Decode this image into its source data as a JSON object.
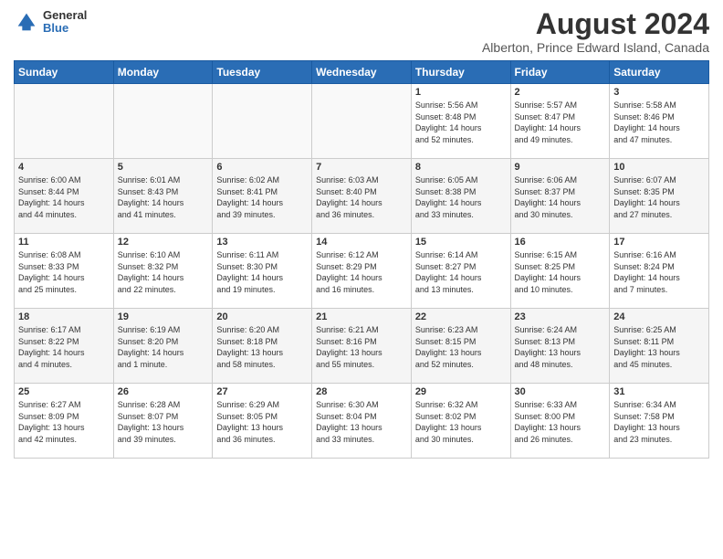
{
  "logo": {
    "general": "General",
    "blue": "Blue"
  },
  "title": {
    "month_year": "August 2024",
    "location": "Alberton, Prince Edward Island, Canada"
  },
  "headers": [
    "Sunday",
    "Monday",
    "Tuesday",
    "Wednesday",
    "Thursday",
    "Friday",
    "Saturday"
  ],
  "weeks": [
    [
      {
        "day": "",
        "info": ""
      },
      {
        "day": "",
        "info": ""
      },
      {
        "day": "",
        "info": ""
      },
      {
        "day": "",
        "info": ""
      },
      {
        "day": "1",
        "info": "Sunrise: 5:56 AM\nSunset: 8:48 PM\nDaylight: 14 hours\nand 52 minutes."
      },
      {
        "day": "2",
        "info": "Sunrise: 5:57 AM\nSunset: 8:47 PM\nDaylight: 14 hours\nand 49 minutes."
      },
      {
        "day": "3",
        "info": "Sunrise: 5:58 AM\nSunset: 8:46 PM\nDaylight: 14 hours\nand 47 minutes."
      }
    ],
    [
      {
        "day": "4",
        "info": "Sunrise: 6:00 AM\nSunset: 8:44 PM\nDaylight: 14 hours\nand 44 minutes."
      },
      {
        "day": "5",
        "info": "Sunrise: 6:01 AM\nSunset: 8:43 PM\nDaylight: 14 hours\nand 41 minutes."
      },
      {
        "day": "6",
        "info": "Sunrise: 6:02 AM\nSunset: 8:41 PM\nDaylight: 14 hours\nand 39 minutes."
      },
      {
        "day": "7",
        "info": "Sunrise: 6:03 AM\nSunset: 8:40 PM\nDaylight: 14 hours\nand 36 minutes."
      },
      {
        "day": "8",
        "info": "Sunrise: 6:05 AM\nSunset: 8:38 PM\nDaylight: 14 hours\nand 33 minutes."
      },
      {
        "day": "9",
        "info": "Sunrise: 6:06 AM\nSunset: 8:37 PM\nDaylight: 14 hours\nand 30 minutes."
      },
      {
        "day": "10",
        "info": "Sunrise: 6:07 AM\nSunset: 8:35 PM\nDaylight: 14 hours\nand 27 minutes."
      }
    ],
    [
      {
        "day": "11",
        "info": "Sunrise: 6:08 AM\nSunset: 8:33 PM\nDaylight: 14 hours\nand 25 minutes."
      },
      {
        "day": "12",
        "info": "Sunrise: 6:10 AM\nSunset: 8:32 PM\nDaylight: 14 hours\nand 22 minutes."
      },
      {
        "day": "13",
        "info": "Sunrise: 6:11 AM\nSunset: 8:30 PM\nDaylight: 14 hours\nand 19 minutes."
      },
      {
        "day": "14",
        "info": "Sunrise: 6:12 AM\nSunset: 8:29 PM\nDaylight: 14 hours\nand 16 minutes."
      },
      {
        "day": "15",
        "info": "Sunrise: 6:14 AM\nSunset: 8:27 PM\nDaylight: 14 hours\nand 13 minutes."
      },
      {
        "day": "16",
        "info": "Sunrise: 6:15 AM\nSunset: 8:25 PM\nDaylight: 14 hours\nand 10 minutes."
      },
      {
        "day": "17",
        "info": "Sunrise: 6:16 AM\nSunset: 8:24 PM\nDaylight: 14 hours\nand 7 minutes."
      }
    ],
    [
      {
        "day": "18",
        "info": "Sunrise: 6:17 AM\nSunset: 8:22 PM\nDaylight: 14 hours\nand 4 minutes."
      },
      {
        "day": "19",
        "info": "Sunrise: 6:19 AM\nSunset: 8:20 PM\nDaylight: 14 hours\nand 1 minute."
      },
      {
        "day": "20",
        "info": "Sunrise: 6:20 AM\nSunset: 8:18 PM\nDaylight: 13 hours\nand 58 minutes."
      },
      {
        "day": "21",
        "info": "Sunrise: 6:21 AM\nSunset: 8:16 PM\nDaylight: 13 hours\nand 55 minutes."
      },
      {
        "day": "22",
        "info": "Sunrise: 6:23 AM\nSunset: 8:15 PM\nDaylight: 13 hours\nand 52 minutes."
      },
      {
        "day": "23",
        "info": "Sunrise: 6:24 AM\nSunset: 8:13 PM\nDaylight: 13 hours\nand 48 minutes."
      },
      {
        "day": "24",
        "info": "Sunrise: 6:25 AM\nSunset: 8:11 PM\nDaylight: 13 hours\nand 45 minutes."
      }
    ],
    [
      {
        "day": "25",
        "info": "Sunrise: 6:27 AM\nSunset: 8:09 PM\nDaylight: 13 hours\nand 42 minutes."
      },
      {
        "day": "26",
        "info": "Sunrise: 6:28 AM\nSunset: 8:07 PM\nDaylight: 13 hours\nand 39 minutes."
      },
      {
        "day": "27",
        "info": "Sunrise: 6:29 AM\nSunset: 8:05 PM\nDaylight: 13 hours\nand 36 minutes."
      },
      {
        "day": "28",
        "info": "Sunrise: 6:30 AM\nSunset: 8:04 PM\nDaylight: 13 hours\nand 33 minutes."
      },
      {
        "day": "29",
        "info": "Sunrise: 6:32 AM\nSunset: 8:02 PM\nDaylight: 13 hours\nand 30 minutes."
      },
      {
        "day": "30",
        "info": "Sunrise: 6:33 AM\nSunset: 8:00 PM\nDaylight: 13 hours\nand 26 minutes."
      },
      {
        "day": "31",
        "info": "Sunrise: 6:34 AM\nSunset: 7:58 PM\nDaylight: 13 hours\nand 23 minutes."
      }
    ]
  ]
}
